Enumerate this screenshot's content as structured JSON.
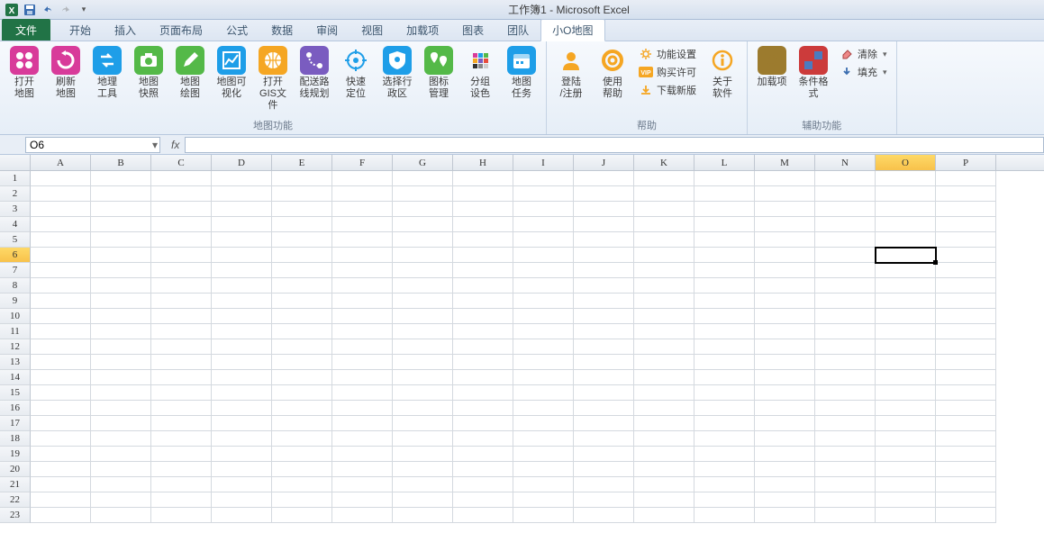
{
  "title": "工作簿1 - Microsoft Excel",
  "tabs": {
    "file": "文件",
    "items": [
      "开始",
      "插入",
      "页面布局",
      "公式",
      "数据",
      "审阅",
      "视图",
      "加载项",
      "图表",
      "团队",
      "小O地图"
    ],
    "active": "小O地图"
  },
  "ribbon": {
    "group1": {
      "label": "地图功能",
      "buttons": [
        {
          "id": "open-map",
          "label": "打开\n地图",
          "color": "#d83b9a",
          "glyph": "grid4"
        },
        {
          "id": "refresh-map",
          "label": "刷新\n地图",
          "color": "#d83b9a",
          "glyph": "refresh"
        },
        {
          "id": "geo-tool",
          "label": "地理\n工具",
          "color": "#1e9ee8",
          "glyph": "swap"
        },
        {
          "id": "map-snap",
          "label": "地图\n快照",
          "color": "#54b948",
          "glyph": "camera"
        },
        {
          "id": "map-draw",
          "label": "地图\n绘图",
          "color": "#54b948",
          "glyph": "pencil"
        },
        {
          "id": "map-vis",
          "label": "地图可\n视化",
          "color": "#1e9ee8",
          "glyph": "chart"
        },
        {
          "id": "open-gis",
          "label": "打开\nGIS文件",
          "color": "#f5a623",
          "glyph": "gis"
        },
        {
          "id": "route",
          "label": "配送路\n线规划",
          "color": "#7a5cc0",
          "glyph": "route"
        },
        {
          "id": "quick-locate",
          "label": "快速\n定位",
          "color": "#1e9ee8",
          "glyph": "target",
          "outline": true
        },
        {
          "id": "select-region",
          "label": "选择行\n政区",
          "color": "#1e9ee8",
          "glyph": "shield"
        },
        {
          "id": "icon-mgr",
          "label": "图标\n管理",
          "color": "#54b948",
          "glyph": "pins"
        },
        {
          "id": "group-color",
          "label": "分组\n设色",
          "color": "#7a5cc0",
          "glyph": "palette",
          "outline": true
        },
        {
          "id": "map-task",
          "label": "地图\n任务",
          "color": "#1e9ee8",
          "glyph": "calendar"
        }
      ]
    },
    "group2": {
      "label": "帮助",
      "big": [
        {
          "id": "login",
          "label": "登陆\n/注册",
          "color": "#f5a623",
          "glyph": "user",
          "outline": true
        },
        {
          "id": "use-help",
          "label": "使用\n帮助",
          "color": "#f5a623",
          "glyph": "life",
          "outline": true
        }
      ],
      "small": [
        {
          "id": "func-set",
          "label": "功能设置",
          "icon": "gear",
          "color": "#f5a623"
        },
        {
          "id": "buy",
          "label": "购买许可",
          "icon": "vip",
          "color": "#f5a623"
        },
        {
          "id": "download",
          "label": "下载新版",
          "icon": "download",
          "color": "#f5a623"
        }
      ],
      "about": {
        "id": "about",
        "label": "关于\n软件",
        "color": "#f5a623",
        "glyph": "info",
        "outline": true
      }
    },
    "group3": {
      "label": "辅助功能",
      "big": [
        {
          "id": "addin",
          "label": "加载项",
          "glyph": "gear-c",
          "color": "#9c7b2e"
        },
        {
          "id": "cond-fmt",
          "label": "条件格式",
          "glyph": "cond",
          "color": "#cc3b3b"
        }
      ],
      "small": [
        {
          "id": "clear",
          "label": "清除",
          "icon": "eraser"
        },
        {
          "id": "fill",
          "label": "填充",
          "icon": "fill"
        }
      ]
    }
  },
  "namebox": "O6",
  "columns": [
    "A",
    "B",
    "C",
    "D",
    "E",
    "F",
    "G",
    "H",
    "I",
    "J",
    "K",
    "L",
    "M",
    "N",
    "O",
    "P"
  ],
  "rows": 23,
  "active": {
    "col": "O",
    "colIndex": 14,
    "rowIndex": 5
  }
}
